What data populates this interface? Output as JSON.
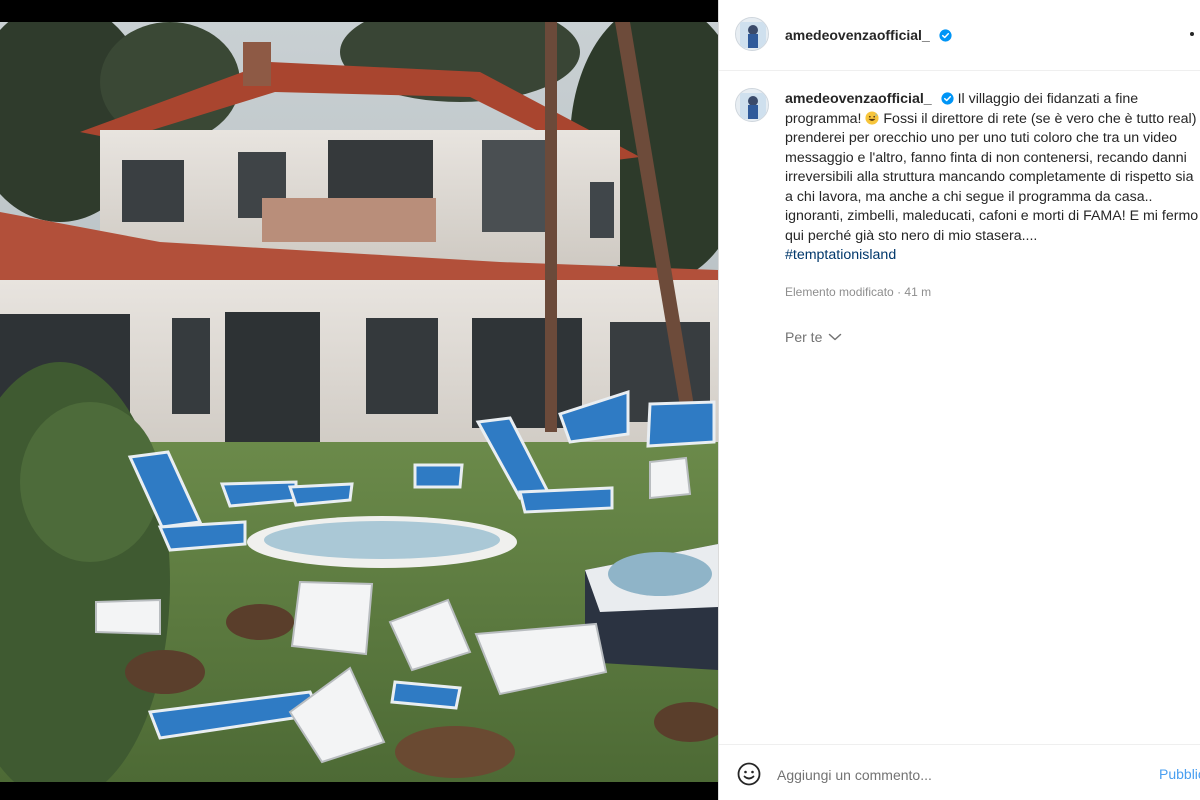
{
  "post": {
    "image_description_alt": "",
    "username": "amedeovenzaofficial_",
    "verified": true,
    "caption": {
      "username": "amedeovenzaofficial_",
      "text_part1": "Il villaggio dei fidanzati a fine programma!",
      "text_part2": "Fossi il direttore di rete (se è vero che è tutto real) prenderei per orecchio uno per uno tuti coloro che tra un video messaggio e l'altro, fanno finta di non contenersi, recando danni irreversibili alla struttura mancando completamente di rispetto sia a chi lavora, ma anche a chi segue il programma da casa.. ignoranti, zimbelli, maleducati, cafoni e morti di FAMA! E mi fermo qui perché già sto nero di mio stasera....",
      "hashtag": "#temptationisland"
    },
    "edited_label": "Elemento modificato",
    "separator": "·",
    "time_ago": "41 m",
    "for_you_label": "Per te"
  },
  "comment_box": {
    "placeholder": "Aggiungi un commento...",
    "publish_label": "Pubblica"
  },
  "colors": {
    "verified_badge": "#0095f6",
    "hashtag": "#00376b",
    "publish": "#4a9ff0",
    "muted": "#8e8e8e"
  },
  "icons": {
    "verified": "verified-badge-icon",
    "more": "more-options-icon",
    "emoji": "grinning-sweat-emoji-icon",
    "chevron": "chevron-down-icon",
    "smile": "emoji-smile-icon"
  }
}
